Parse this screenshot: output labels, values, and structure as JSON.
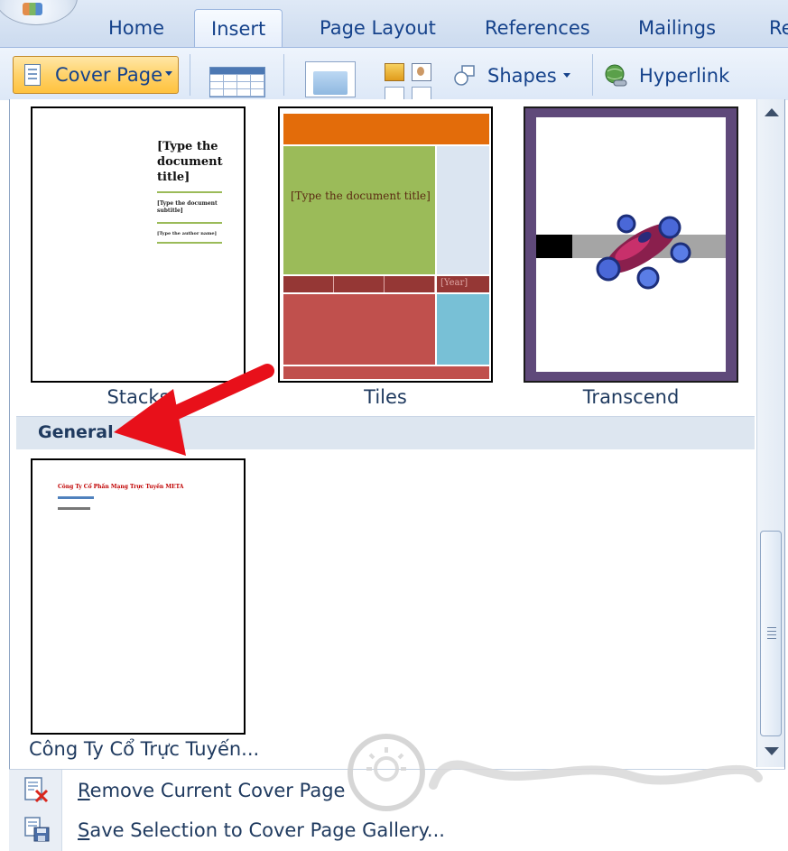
{
  "ribbon": {
    "tabs": [
      "Home",
      "Insert",
      "Page Layout",
      "References",
      "Mailings",
      "Re"
    ],
    "active_tab": "Insert",
    "cover_page_label": "Cover Page",
    "shapes_label": "Shapes",
    "hyperlink_label": "Hyperlink"
  },
  "gallery": {
    "thumbnails": [
      {
        "label": "Stacks",
        "title_text": "[Type the document title]",
        "subtitle_text": "[Type the document subtitle]",
        "author_text": "[Type the author name]"
      },
      {
        "label": "Tiles",
        "title_text": "[Type the document title]",
        "year_text": "[Year]"
      },
      {
        "label": "Transcend"
      }
    ],
    "section_general": "General",
    "general_thumb": {
      "label": "Công Ty Cổ Trực Tuyến...",
      "line1": "Công Ty Cổ Phần Mạng Trực Tuyến META"
    }
  },
  "menu": {
    "remove_first": "R",
    "remove_rest": "emove Current Cover Page",
    "save_first": "S",
    "save_rest": "ave Selection to Cover Page Gallery..."
  },
  "colors": {
    "ribbon_text": "#15428b",
    "highlight_button": "#ffd26a",
    "arrow": "#e8101a"
  }
}
